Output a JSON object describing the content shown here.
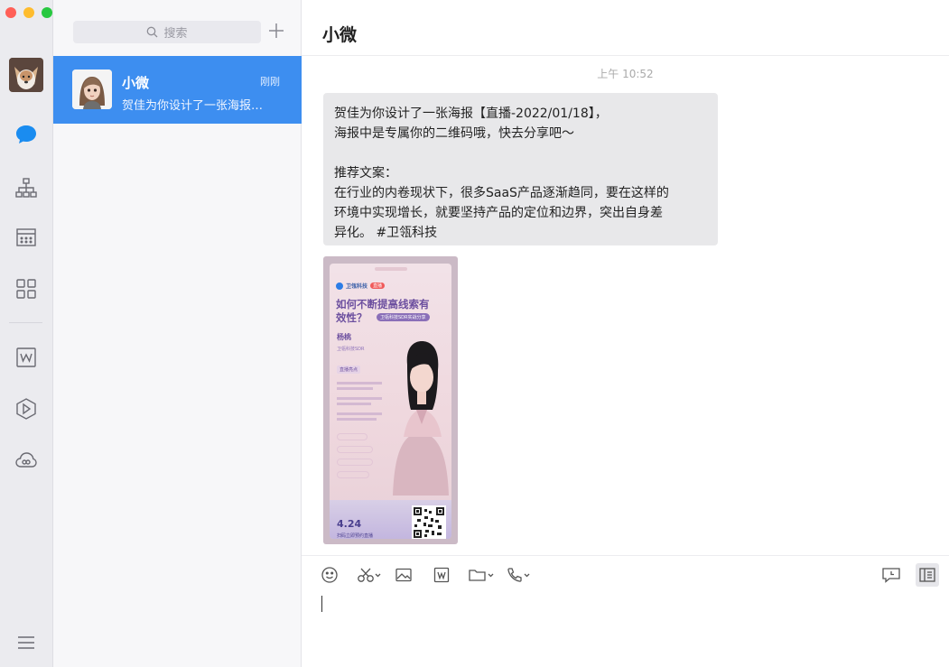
{
  "window": {
    "traffic_lights": [
      "#ff5f57",
      "#febc2e",
      "#28c840"
    ]
  },
  "rail": {
    "items": [
      {
        "icon": "chat-bubble-icon",
        "active": true
      },
      {
        "icon": "org-chart-icon"
      },
      {
        "icon": "calendar-icon"
      },
      {
        "icon": "apps-grid-icon"
      },
      {
        "icon": "document-w-icon"
      },
      {
        "icon": "hexagon-app-icon"
      },
      {
        "icon": "cloud-drive-icon"
      },
      {
        "icon": "menu-icon"
      }
    ]
  },
  "search": {
    "placeholder": "搜索"
  },
  "conversations": [
    {
      "name": "小微",
      "time": "刚刚",
      "preview": "贺佳为你设计了一张海报…"
    }
  ],
  "chat": {
    "title": "小微",
    "timestamp": "上午 10:52",
    "message_lines": [
      "贺佳为你设计了一张海报【直播-2022/01/18】，",
      "海报中是专属你的二维码哦，快去分享吧～",
      "",
      "推荐文案：",
      "在行业的内卷现状下，很多SaaS产品逐渐趋同，要在这样的",
      "环境中实现增长，就要坚持产品的定位和边界，突出自身差",
      "异化。 #卫瓴科技"
    ],
    "poster": {
      "brand": "卫瓴科技",
      "tag": "直播",
      "headline_1": "如何不断提高线索有",
      "headline_2": "效性？",
      "subtitle": "卫瓴科技SDR实战分享",
      "speaker": "杨桃",
      "speaker_title": "卫瓴科技SDR",
      "section": "直播亮点",
      "date": "4.24",
      "footer": "扫码立即预约直播"
    }
  },
  "colors": {
    "accent": "#3d8ef0",
    "bubble": "#e8e8ea"
  }
}
